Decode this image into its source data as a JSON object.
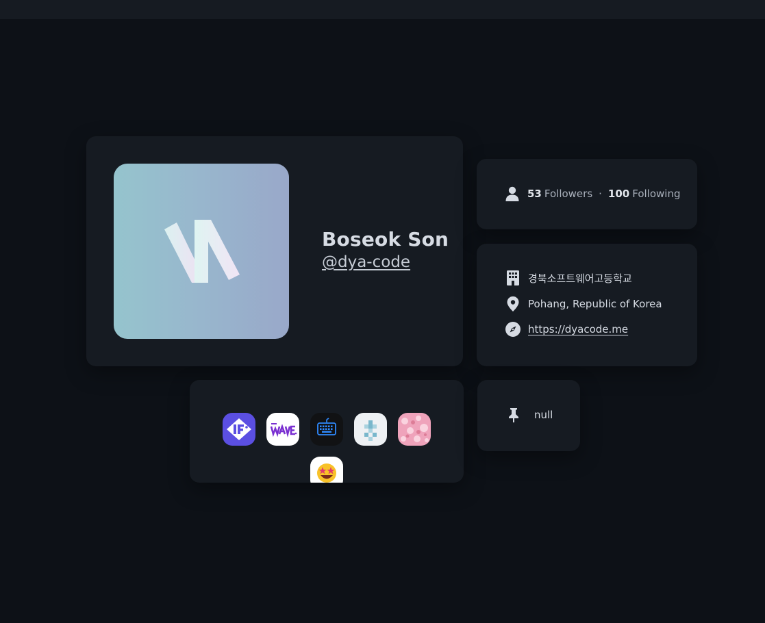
{
  "profile": {
    "name": "Boseok Son",
    "handle": "@dya-code"
  },
  "follow": {
    "followers_count": "53",
    "followers_label": "Followers",
    "separator": "·",
    "following_count": "100",
    "following_label": "Following"
  },
  "info": {
    "organization": "경북소프트웨어고등학교",
    "location": "Pohang, Republic of Korea",
    "website": "https://dyacode.me"
  },
  "apps": [
    {
      "icon": "if-app-icon",
      "color": "#5a4fe0"
    },
    {
      "icon": "wave-app-icon",
      "color": "#ffffff"
    },
    {
      "icon": "keyboard-app-icon",
      "color": "#111111"
    },
    {
      "icon": "pixel-cross-app-icon",
      "color": "#eef1f4"
    },
    {
      "icon": "pink-texture-app-icon",
      "color": "#f2a8bf"
    },
    {
      "icon": "star-struck-emoji-app-icon",
      "color": "#ffffff"
    }
  ],
  "pinned": {
    "label": "null"
  },
  "colors": {
    "background": "#0d1117",
    "card": "#161b22",
    "text": "#d6dbe3"
  }
}
